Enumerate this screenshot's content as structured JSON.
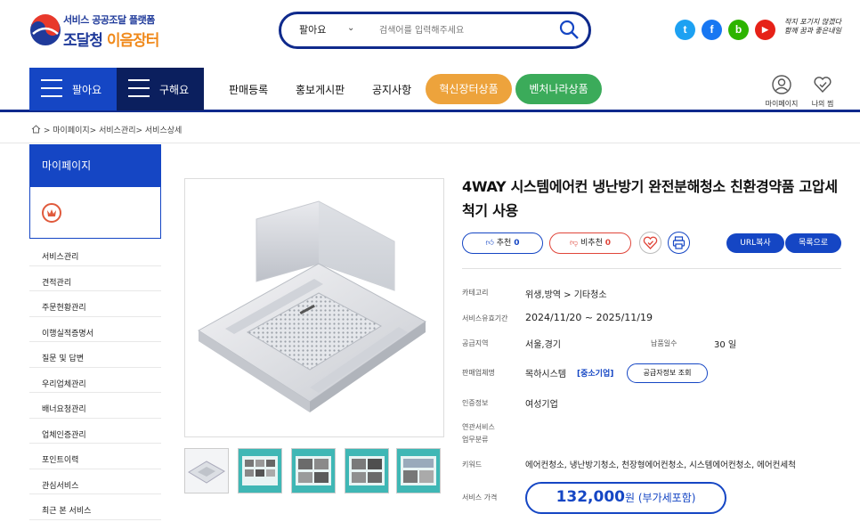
{
  "header": {
    "logo_sub": "서비스 공공조달 플랫폼",
    "logo_main_a": "조달청 ",
    "logo_main_b": "이음장터",
    "search_select": "팔아요",
    "search_placeholder": "검색어를 입력해주세요",
    "sns": [
      {
        "name": "twitter",
        "glyph": "t",
        "color": "#1da1f2"
      },
      {
        "name": "facebook",
        "glyph": "f",
        "color": "#1877f2"
      },
      {
        "name": "blog",
        "glyph": "b",
        "color": "#2db400"
      },
      {
        "name": "youtube",
        "glyph": "▶",
        "color": "#e62117"
      }
    ],
    "slogan": "작지 포기지 않겠다 함께 꿈과 좋은내일"
  },
  "nav": {
    "sell": "팔아요",
    "buy": "구해요",
    "links": [
      "판매등록",
      "홍보게시판",
      "공지사항"
    ],
    "innov": "혁신장터상품",
    "venture": "벤처나라상품",
    "mypage": "마이페이지",
    "mypick": "나의 찜",
    "accent": "#1546c4",
    "innov_color": "#eda33c",
    "venture_color": "#3bab5a"
  },
  "breadcrumb": "> 마이페이지> 서비스관리> 서비스상세",
  "sidebar": {
    "title": "마이페이지",
    "items": [
      "서비스관리",
      "견적관리",
      "주문현황관리",
      "이행실적증명서",
      "질문 및 답변",
      "우리업체관리",
      "배너요청관리",
      "업체인증관리",
      "포인트이력",
      "관심서비스",
      "최근 본 서비스"
    ]
  },
  "product": {
    "title": "4WAY 시스템에어컨 냉난방기 완전분해청소 친환경약품 고압세척기 사용",
    "like_label": "추천",
    "like_count": "0",
    "dislike_label": "비추천",
    "dislike_count": "0",
    "url_copy": "URL복사",
    "to_list": "목록으로",
    "category_label": "카테고리",
    "category": "위생,방역 > 기타청소",
    "period_label": "서비스유효기간",
    "period": "2024/11/20 ~ 2025/11/19",
    "region_label": "공급지역",
    "region": "서울,경기",
    "lead_label": "납품일수",
    "lead": "30 일",
    "seller_label": "판매업체명",
    "seller": "목하시스템",
    "seller_tag": "[중소기업]",
    "supplier_btn": "공급자정보 조회",
    "cert_label": "인증정보",
    "cert": "여성기업",
    "related_label_1": "연관서비스",
    "related_label_2": "업무분류",
    "keyword_label": "키워드",
    "keywords": "에어컨청소, 냉난방기청소, 천장형에어컨청소, 시스템에어컨청소, 에어컨세척",
    "price_label": "서비스 가격",
    "price": "132,000",
    "price_unit": "원 (부가세포함)"
  }
}
